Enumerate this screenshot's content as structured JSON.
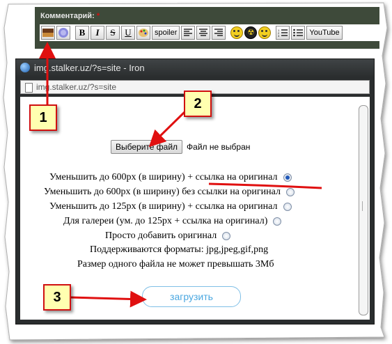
{
  "forum": {
    "comment_label": "Комментарий:",
    "required_mark": "*",
    "toolbar": {
      "bold": "B",
      "italic": "I",
      "strike": "S",
      "underline": "U",
      "spoiler": "spoiler",
      "youtube": "YouTube"
    }
  },
  "popup": {
    "title": "img.stalker.uz/?s=site - Iron",
    "address": "img.stalker.uz/?s=site",
    "file_button": "Выберите файл",
    "file_status": "Файл не выбран",
    "options": [
      {
        "label": "Уменьшить до 600px (в ширину) + ссылка на оригинал",
        "selected": true
      },
      {
        "label": "Уменьшить до 600px (в ширину) без ссылки на оригинал",
        "selected": false
      },
      {
        "label": "Уменьшить до 125px (в ширину) + ссылка на оригинал",
        "selected": false
      },
      {
        "label": "Для галереи (ум. до 125px + ссылка на оригинал)",
        "selected": false
      },
      {
        "label": "Просто добавить оригинал",
        "selected": false
      }
    ],
    "formats_text": "Поддерживаются форматы: jpg,jpeg,gif,png",
    "size_limit_text": "Размер одного файла не может превышать 3Мб",
    "upload_button": "загрузить"
  },
  "callouts": [
    "1",
    "2",
    "3"
  ],
  "colors": {
    "callout_border": "#d01010",
    "callout_fill": "#ffffb0",
    "arrow": "#e01010",
    "upload_text": "#4aa7e0"
  }
}
